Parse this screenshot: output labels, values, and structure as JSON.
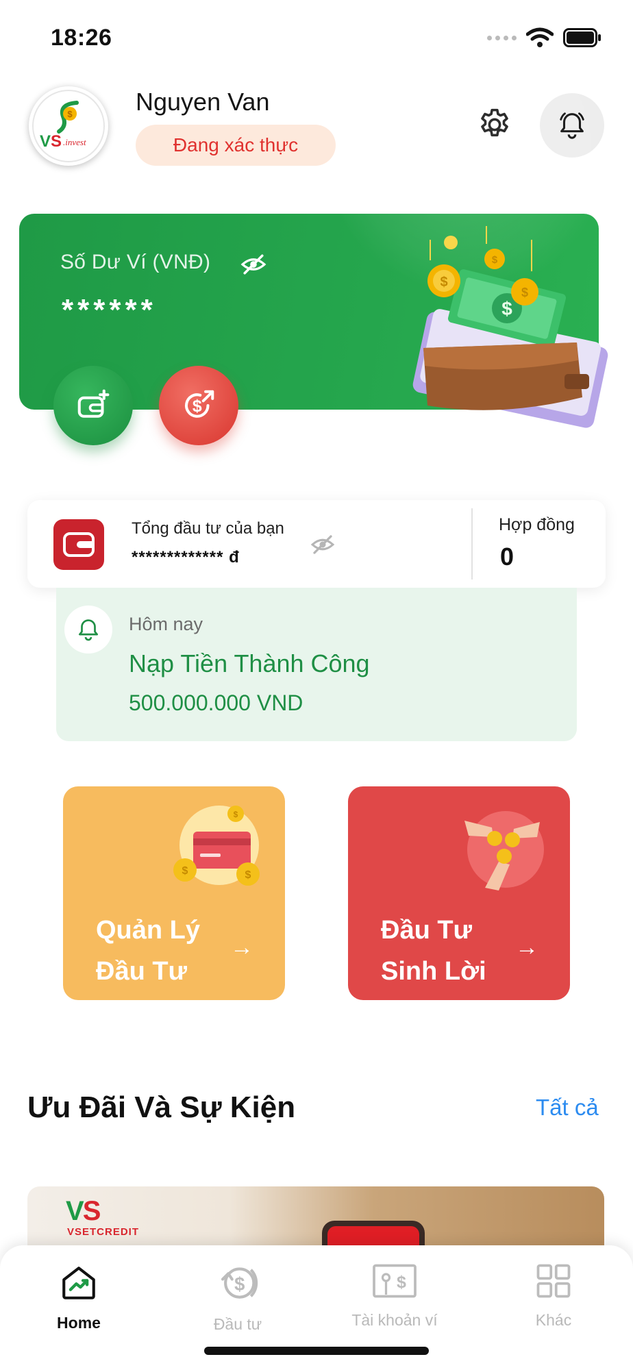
{
  "status_bar": {
    "time": "18:26"
  },
  "header": {
    "user_name": "Nguyen Van",
    "verification_status": "Đang xác thực",
    "logo_text": "VS.invest"
  },
  "wallet": {
    "label": "Số Dư Ví (VNĐ)",
    "balance_masked": "******",
    "deposit_label": "Nạp tiền",
    "withdraw_label": "Rút tiền"
  },
  "investment_summary": {
    "label": "Tổng đầu tư của bạn",
    "amount_masked": "************* đ",
    "contracts_label": "Hợp đồng",
    "contracts_count": "0"
  },
  "notification": {
    "date": "Hôm nay",
    "title": "Nạp Tiền Thành Công",
    "amount": "500.000.000 VND"
  },
  "tiles": [
    {
      "line1": "Quản Lý",
      "line2": "Đầu Tư",
      "color": "#f7bb5e"
    },
    {
      "line1": "Đầu Tư",
      "line2": "Sinh Lời",
      "color": "#e04848"
    }
  ],
  "promotions": {
    "title": "Ưu Đãi Và Sự Kiện",
    "see_all": "Tất cả",
    "banner_brand": "VSETCREDIT"
  },
  "bottom_nav": {
    "items": [
      {
        "label": "Home",
        "icon": "home-chart-icon",
        "active": true
      },
      {
        "label": "Đầu tư",
        "icon": "coin-cycle-icon",
        "active": false
      },
      {
        "label": "Tài khoản ví",
        "icon": "wallet-bill-icon",
        "active": false
      },
      {
        "label": "Khác",
        "icon": "grid-icon",
        "active": false
      }
    ]
  },
  "colors": {
    "primary_green": "#25a64d",
    "accent_red": "#e04848",
    "accent_orange": "#f7bb5e",
    "link_blue": "#2d8cf0"
  }
}
